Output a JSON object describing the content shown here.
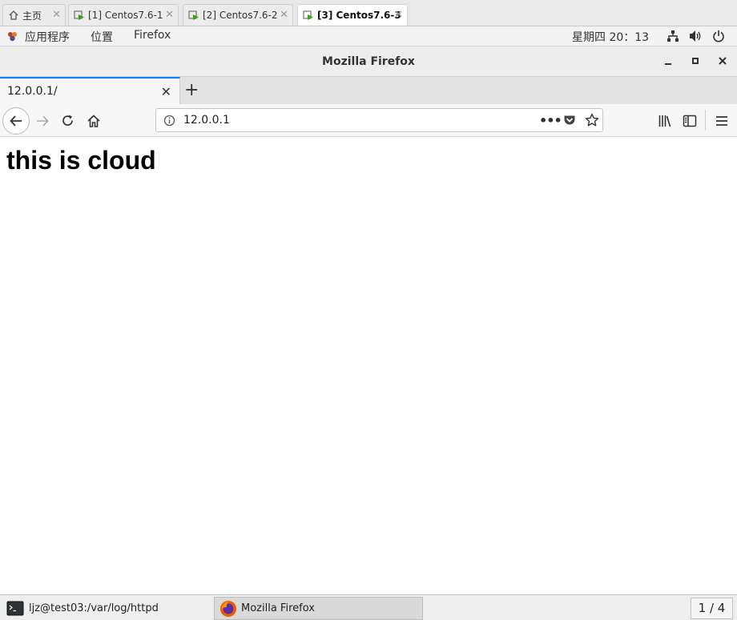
{
  "vm_tabs": [
    {
      "label": "主页",
      "active": false
    },
    {
      "label": "[1] Centos7.6-1",
      "active": false
    },
    {
      "label": "[2] Centos7.6-2",
      "active": false
    },
    {
      "label": "[3] Centos7.6-3",
      "active": true
    }
  ],
  "gnome_bar": {
    "applications": "应用程序",
    "places": "位置",
    "app_name": "Firefox",
    "clock": "星期四 20：13"
  },
  "window": {
    "title": "Mozilla Firefox"
  },
  "browser": {
    "tab_title": "12.0.0.1/",
    "url": "12.0.0.1"
  },
  "page": {
    "heading": "this is cloud"
  },
  "taskbar": {
    "terminal_label": "ljz@test03:/var/log/httpd",
    "firefox_label": "Mozilla Firefox",
    "workspace": "1 / 4"
  },
  "colors": {
    "accent": "#0a84ff",
    "vm_icon_green": "#3aa31b"
  },
  "icons": {
    "home": "home-icon",
    "vm": "vm-icon",
    "back": "arrow-left-icon",
    "forward": "arrow-right-icon",
    "reload": "reload-icon",
    "info": "info-icon",
    "more": "ellipsis-icon",
    "pocket": "pocket-icon",
    "bookmark": "star-icon",
    "library": "library-icon",
    "sidebar": "sidebar-icon",
    "menu": "hamburger-icon"
  }
}
